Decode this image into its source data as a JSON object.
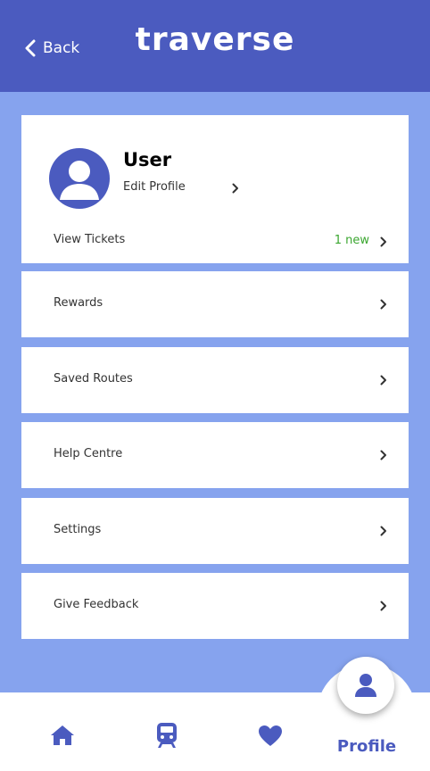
{
  "header": {
    "back_label": "Back",
    "brand": "traverse"
  },
  "profile": {
    "name": "User",
    "edit_label": "Edit Profile",
    "tickets_label": "View Tickets",
    "tickets_badge": "1 new"
  },
  "menu": [
    {
      "label": "Rewards"
    },
    {
      "label": "Saved Routes"
    },
    {
      "label": "Help Centre"
    },
    {
      "label": "Settings"
    },
    {
      "label": "Give Feedback"
    }
  ],
  "nav": {
    "items": [
      {
        "icon": "home-icon"
      },
      {
        "icon": "train-icon"
      },
      {
        "icon": "heart-icon"
      },
      {
        "icon": "user-icon",
        "label": "Profile"
      }
    ]
  },
  "colors": {
    "header": "#4b5bbf",
    "background": "#86a3ee",
    "accent": "#4b5bbf",
    "badge": "#3aa62f"
  }
}
